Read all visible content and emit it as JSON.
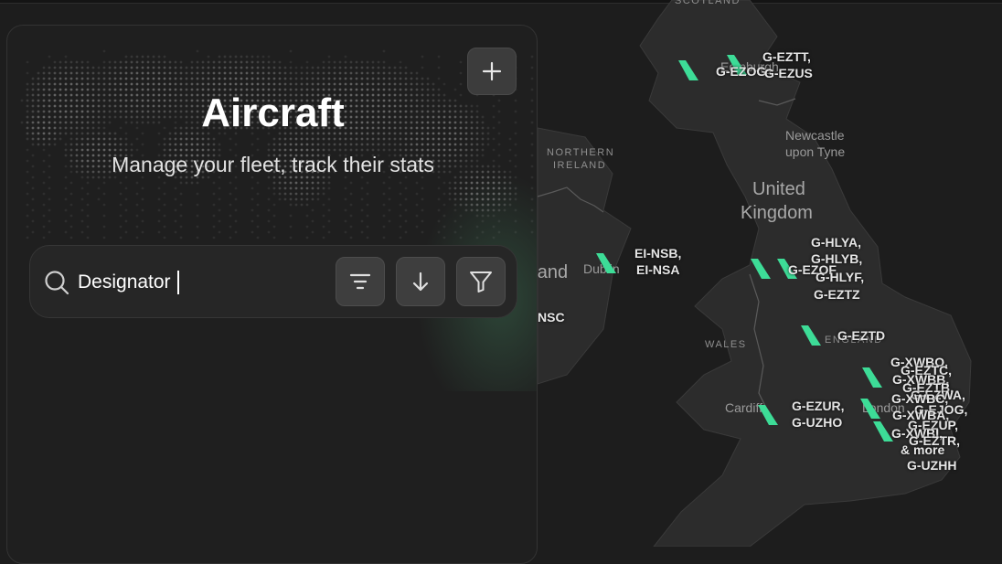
{
  "panel": {
    "title": "Aircraft",
    "subtitle": "Manage your fleet, track their stats",
    "add_button": {
      "icon": "plus-icon"
    },
    "search": {
      "icon": "search-icon",
      "placeholder": "Designator",
      "value": ""
    },
    "toolbar": [
      {
        "name": "sort-lines-button",
        "icon": "sort-lines-icon"
      },
      {
        "name": "sort-direction-button",
        "icon": "arrow-down-icon"
      },
      {
        "name": "filter-button",
        "icon": "funnel-icon"
      }
    ]
  },
  "map": {
    "regions": {
      "scotland": "SCOTLAND",
      "northern_ireland_1": "NORTHERN",
      "northern_ireland_2": "IRELAND",
      "wales": "WALES",
      "england": "ENGLAND"
    },
    "cities": {
      "edinburgh": "Edinburgh",
      "newcastle_1": "Newcastle",
      "newcastle_2": "upon Tyne",
      "dublin": "Dublin",
      "cardiff": "Cardiff",
      "london": "London"
    },
    "countries": {
      "uk_1": "United",
      "uk_2": "Kingdom",
      "ireland": "Ireland"
    },
    "aircraft_labels": {
      "edinburgh_a": "G-EZTT,",
      "edinburgh_b": "G-EZOG",
      "edinburgh_c": "G-EZUS",
      "dublin_a": "EI-NSB,",
      "dublin_b": "EI-NSA",
      "partial_nsc": "NSC",
      "north_a": "G-HLYA,",
      "north_b": "G-HLYB,",
      "north_c": "G-EZOF",
      "north_d": "G-HLYF,",
      "north_e": "G-EZTZ",
      "mid": "G-EZTD",
      "sw_a": "G-EZUR,",
      "sw_b": "G-UZHO",
      "ln_1": "G-XWBO,",
      "ln_2": "G-EZTC,",
      "ln_3": "G-XWBB,",
      "ln_4": "G-EZTB,",
      "ln_5": "G-EZWA,",
      "ln_6": "G-XWBC,",
      "ln_7": "G-EJOG,",
      "ln_8": "G-XWBA,",
      "ln_9": "G-EZUP,",
      "ln_10": "G-XWBI,",
      "ln_11": "G-EZTR,",
      "ln_12": "& more",
      "ln_13": "G-UZHH"
    },
    "colors": {
      "land": "#2c2c2c",
      "water": "#1d1d1d",
      "aircraft": "#3ddc97"
    }
  }
}
